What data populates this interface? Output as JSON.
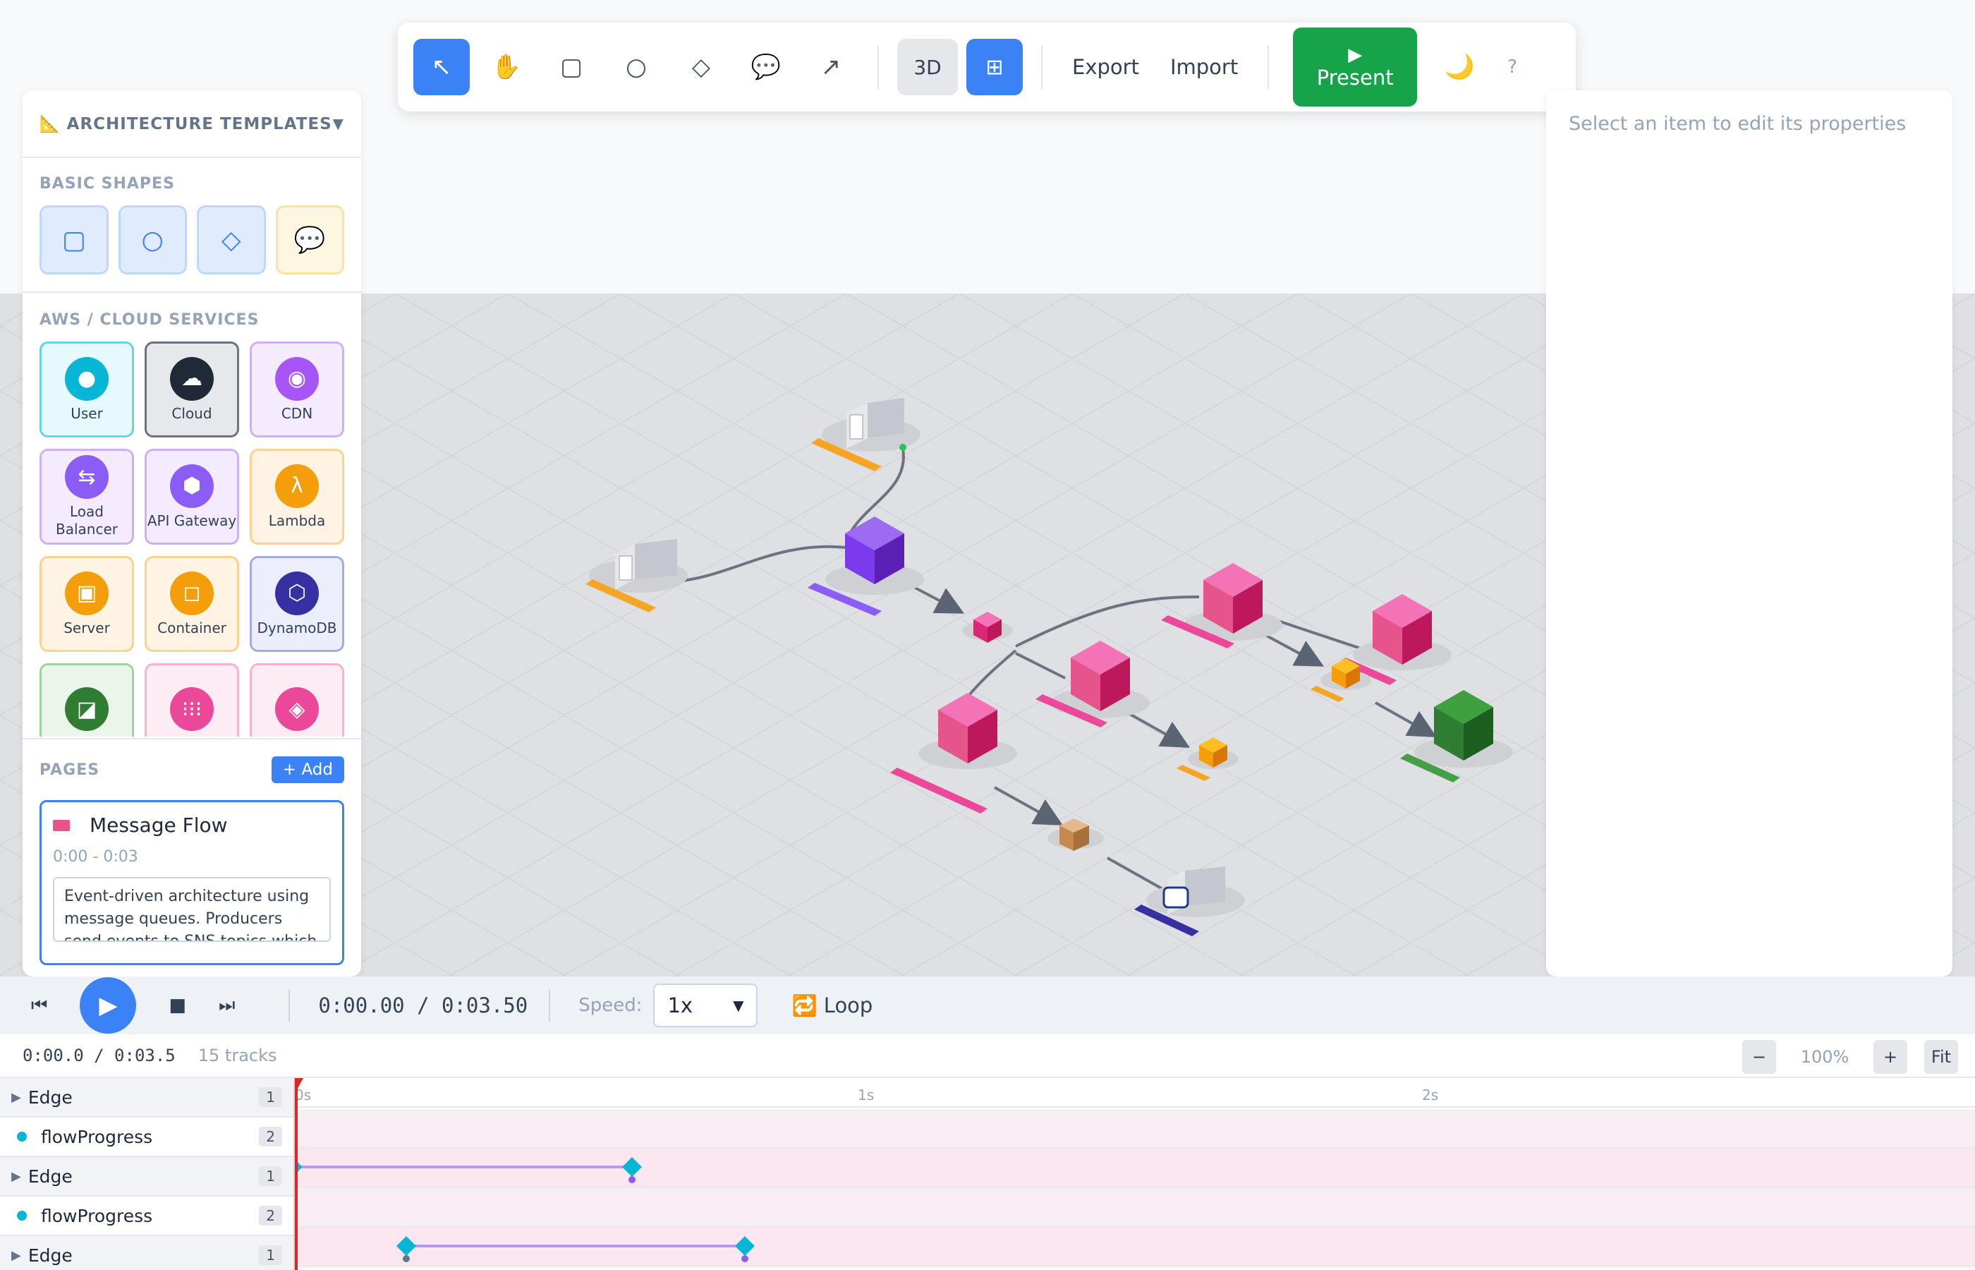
{
  "toolbar": {
    "tools": [
      {
        "name": "select-tool",
        "glyph": "↖"
      },
      {
        "name": "pan-tool",
        "glyph": "✋"
      },
      {
        "name": "rectangle-tool",
        "glyph": "▢"
      },
      {
        "name": "circle-tool",
        "glyph": "○"
      },
      {
        "name": "diamond-tool",
        "glyph": "◇"
      },
      {
        "name": "comment-tool",
        "glyph": "💬"
      },
      {
        "name": "arrow-tool",
        "glyph": "↗"
      }
    ],
    "view_3d": "3D",
    "grid_glyph": "⊞",
    "export": "Export",
    "import": "Import",
    "present_icon": "▶",
    "present": "Present",
    "theme_glyph": "🌙",
    "help": "?"
  },
  "left_panel": {
    "templates_header": "📐 ARCHITECTURE TEMPLATES",
    "templates_caret": "▼",
    "basic_shapes_title": "BASIC SHAPES",
    "basic_shapes": [
      {
        "glyph": "▢",
        "style": "b",
        "icon": "rectangle-icon"
      },
      {
        "glyph": "○",
        "style": "b",
        "icon": "circle-icon"
      },
      {
        "glyph": "◇",
        "style": "b",
        "icon": "diamond-icon"
      },
      {
        "glyph": "💬",
        "style": "y",
        "icon": "speech-bubble-icon"
      }
    ],
    "cloud_title": "AWS / CLOUD SERVICES",
    "services": [
      {
        "label": "User",
        "glyph": "●",
        "bg": "#e6f9fc",
        "border": "#67d3e6",
        "color": "#06b6d4",
        "icon": "user-icon"
      },
      {
        "label": "Cloud",
        "glyph": "☁",
        "bg": "#e7e8eb",
        "border": "#6b7280",
        "color": "#1f2937",
        "icon": "cloud-icon"
      },
      {
        "label": "CDN",
        "glyph": "◉",
        "bg": "#f4ecfe",
        "border": "#cdb0f8",
        "color": "#a855f7",
        "icon": "cdn-icon"
      },
      {
        "label": "Load Balancer",
        "glyph": "⇆",
        "bg": "#f4ecfe",
        "border": "#cdb0f8",
        "color": "#8b5cf6",
        "icon": "load-balancer-icon"
      },
      {
        "label": "API Gateway",
        "glyph": "⬢",
        "bg": "#f4ecfe",
        "border": "#cdb0f8",
        "color": "#8b5cf6",
        "icon": "api-gateway-icon"
      },
      {
        "label": "Lambda",
        "glyph": "λ",
        "bg": "#fff4e4",
        "border": "#fbd28f",
        "color": "#f59e0b",
        "icon": "lambda-icon"
      },
      {
        "label": "Server",
        "glyph": "▣",
        "bg": "#fff4e4",
        "border": "#fbd28f",
        "color": "#f59e0b",
        "icon": "server-icon"
      },
      {
        "label": "Container",
        "glyph": "◻",
        "bg": "#fff4e4",
        "border": "#fbd28f",
        "color": "#f59e0b",
        "icon": "container-icon"
      },
      {
        "label": "DynamoDB",
        "glyph": "⬡",
        "bg": "#eceefb",
        "border": "#a5abe9",
        "color": "#3730a3",
        "icon": "dynamodb-icon"
      },
      {
        "label": "",
        "glyph": "◪",
        "bg": "#eaf6ea",
        "border": "#9fd49f",
        "color": "#2e7d32",
        "icon": "storage-icon"
      },
      {
        "label": "",
        "glyph": "⁝⁝⁝",
        "bg": "#fdecf3",
        "border": "#f6b3cf",
        "color": "#ec4899",
        "icon": "queue-icon"
      },
      {
        "label": "",
        "glyph": "◈",
        "bg": "#fdecf3",
        "border": "#f6b3cf",
        "color": "#ec4899",
        "icon": "topic-icon"
      }
    ],
    "pages_title": "PAGES",
    "add_page": "+ Add",
    "page": {
      "title": "Message Flow",
      "time": "0:00 - 0:03",
      "description": "Event-driven architecture using message queues. Producers send events to SNS topics which"
    }
  },
  "properties": {
    "placeholder": "Select an item to edit its properties"
  },
  "player": {
    "skip_back": "⏮",
    "play": "▶",
    "stop": "■",
    "skip_forward": "⏭",
    "time": "0:00.00 / 0:03.50",
    "speed_label": "Speed:",
    "speed_value": "1x",
    "speed_options": [
      "1x"
    ],
    "loop": "🔁 Loop"
  },
  "timeline": {
    "time": "0:00.0 / 0:03.5",
    "tracks_count": "15 tracks",
    "zoom_out": "−",
    "zoom": "100%",
    "zoom_in": "+",
    "fit": "Fit",
    "ruler": [
      "0s",
      "1s",
      "2s"
    ],
    "tracks": [
      {
        "type": "group",
        "label": "Edge",
        "count": "1"
      },
      {
        "type": "prop",
        "label": "flowProgress",
        "count": "2"
      },
      {
        "type": "group",
        "label": "Edge",
        "count": "1"
      },
      {
        "type": "prop",
        "label": "flowProgress",
        "count": "2"
      },
      {
        "type": "group",
        "label": "Edge",
        "count": "1"
      }
    ]
  },
  "colors": {
    "accent": "#3b82f6",
    "present": "#16a34a",
    "playhead": "#dc2626",
    "keyframe": "#06b6d4",
    "queue": "#e5548a",
    "api": "#7c3aed",
    "lambda": "#f5a524",
    "sqs": "#2e8b2e"
  }
}
